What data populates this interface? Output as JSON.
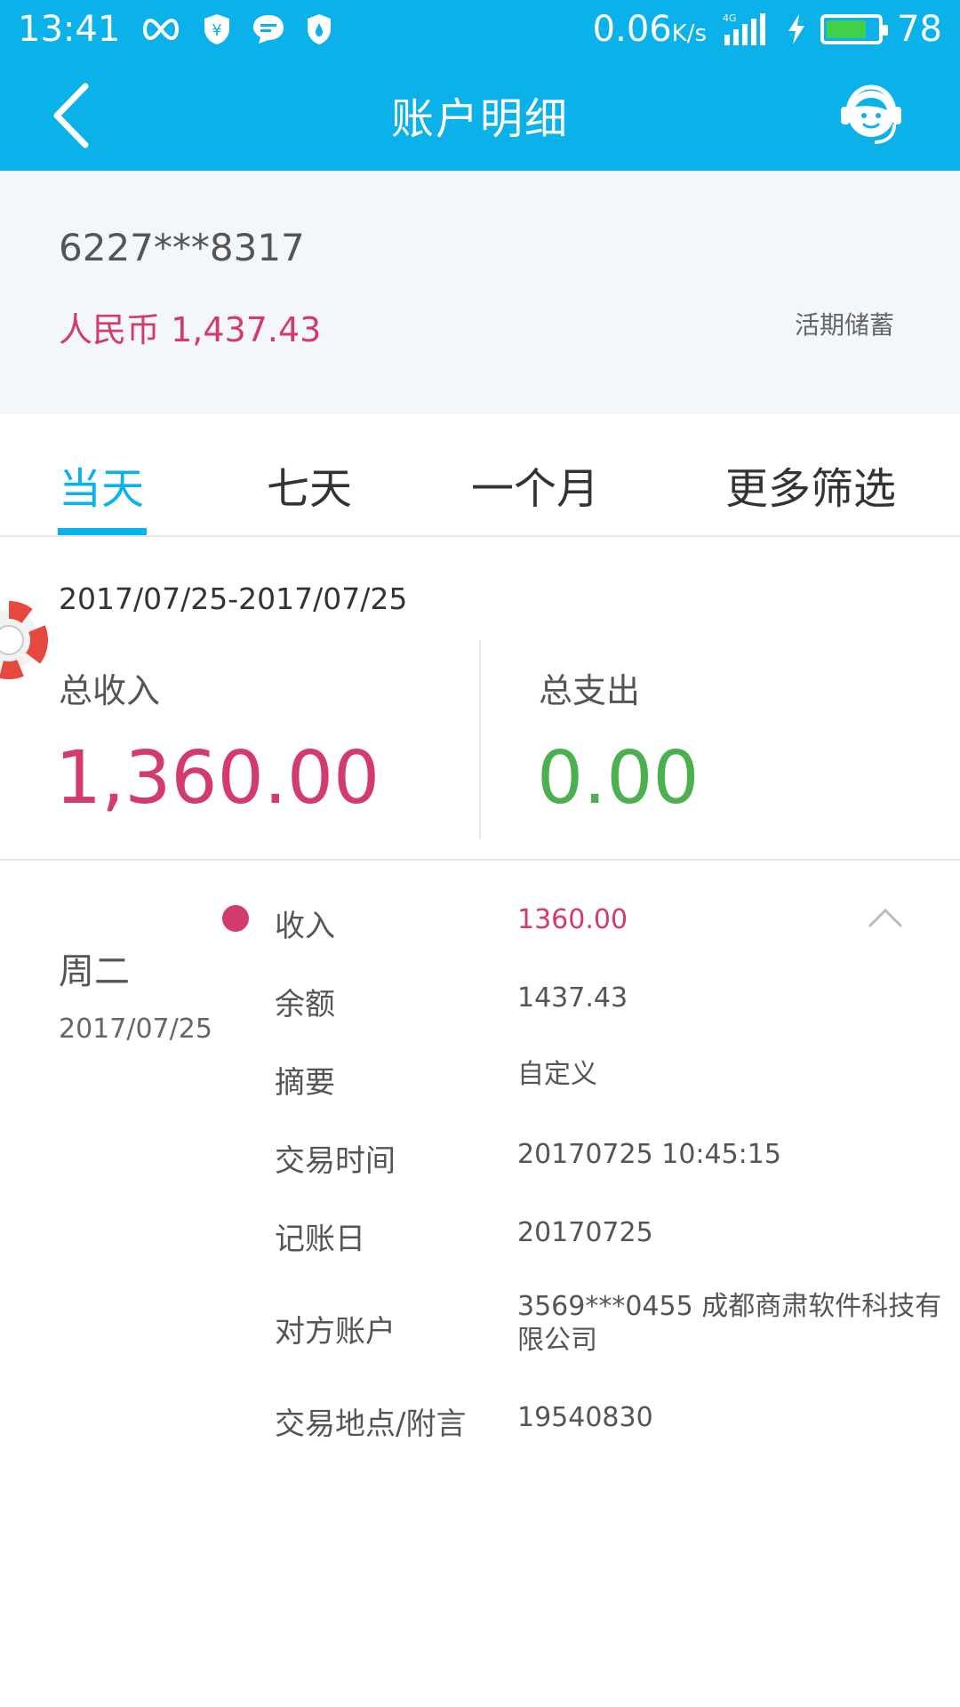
{
  "status_bar": {
    "time": "13:41",
    "speed": "0.06",
    "speed_unit": "K/s",
    "network": "4G",
    "battery": "78",
    "battery_level": 0.78,
    "icons": [
      "infinity-icon",
      "yen-shield-icon",
      "chat-icon",
      "shield-icon",
      "signal-icon",
      "charging-icon",
      "battery-icon"
    ]
  },
  "header": {
    "title": "账户明细",
    "back_icon": "back-arrow-icon",
    "service_icon": "customer-service-icon"
  },
  "account": {
    "number": "6227***8317",
    "balance_text": "人民币 1,437.43",
    "type": "活期储蓄"
  },
  "tabs": [
    {
      "label": "当天",
      "active": true
    },
    {
      "label": "七天",
      "active": false
    },
    {
      "label": "一个月",
      "active": false
    },
    {
      "label": "更多筛选",
      "active": false
    }
  ],
  "summary": {
    "date_range": "2017/07/25-2017/07/25",
    "income_label": "总收入",
    "income_value": "1,360.00",
    "expense_label": "总支出",
    "expense_value": "0.00"
  },
  "transaction": {
    "weekday": "周二",
    "date": "2017/07/25",
    "rows": [
      {
        "label": "收入",
        "value": "1360.00"
      },
      {
        "label": "余额",
        "value": "1437.43"
      },
      {
        "label": "摘要",
        "value": "自定义"
      },
      {
        "label": "交易时间",
        "value": "20170725 10:45:15"
      },
      {
        "label": "记账日",
        "value": "20170725"
      },
      {
        "label": "对方账户",
        "value": "3569***0455 成都商肃软件科技有限公司"
      },
      {
        "label": "交易地点/附言",
        "value": "19540830"
      }
    ]
  },
  "colors": {
    "primary": "#0bb2ea",
    "income": "#d23b6b",
    "expense": "#4caf50",
    "card_bg": "#f3f7fa"
  }
}
